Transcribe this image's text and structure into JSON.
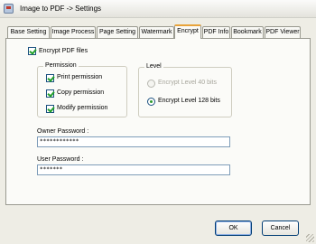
{
  "window": {
    "title": "Image to PDF -> Settings"
  },
  "tabs": [
    {
      "label": "Base Setting",
      "active": false
    },
    {
      "label": "Image Process",
      "active": false
    },
    {
      "label": "Page Setting",
      "active": false
    },
    {
      "label": "Watermark",
      "active": false
    },
    {
      "label": "Encrypt",
      "active": true
    },
    {
      "label": "PDF Info",
      "active": false
    },
    {
      "label": "Bookmark",
      "active": false
    },
    {
      "label": "PDF Viewer",
      "active": false
    }
  ],
  "encrypt": {
    "enable_label": "Encrypt PDF files",
    "enable_checked": true,
    "permission": {
      "title": "Permission",
      "print_label": "Print permission",
      "copy_label": "Copy permission",
      "modify_label": "Modify permission",
      "print_checked": true,
      "copy_checked": true,
      "modify_checked": true
    },
    "level": {
      "title": "Level",
      "level40_label": "Encrypt Level 40 bits",
      "level128_label": "Encrypt Level 128 bits",
      "selected": "128"
    },
    "owner_password": {
      "label": "Owner Password :",
      "value": "************"
    },
    "user_password": {
      "label": "User Password :",
      "value": "*******"
    }
  },
  "buttons": {
    "ok": "OK",
    "cancel": "Cancel"
  },
  "colors": {
    "accent_tab": "#e8a33a",
    "check_green": "#22a12a",
    "button_border": "#003c74"
  }
}
